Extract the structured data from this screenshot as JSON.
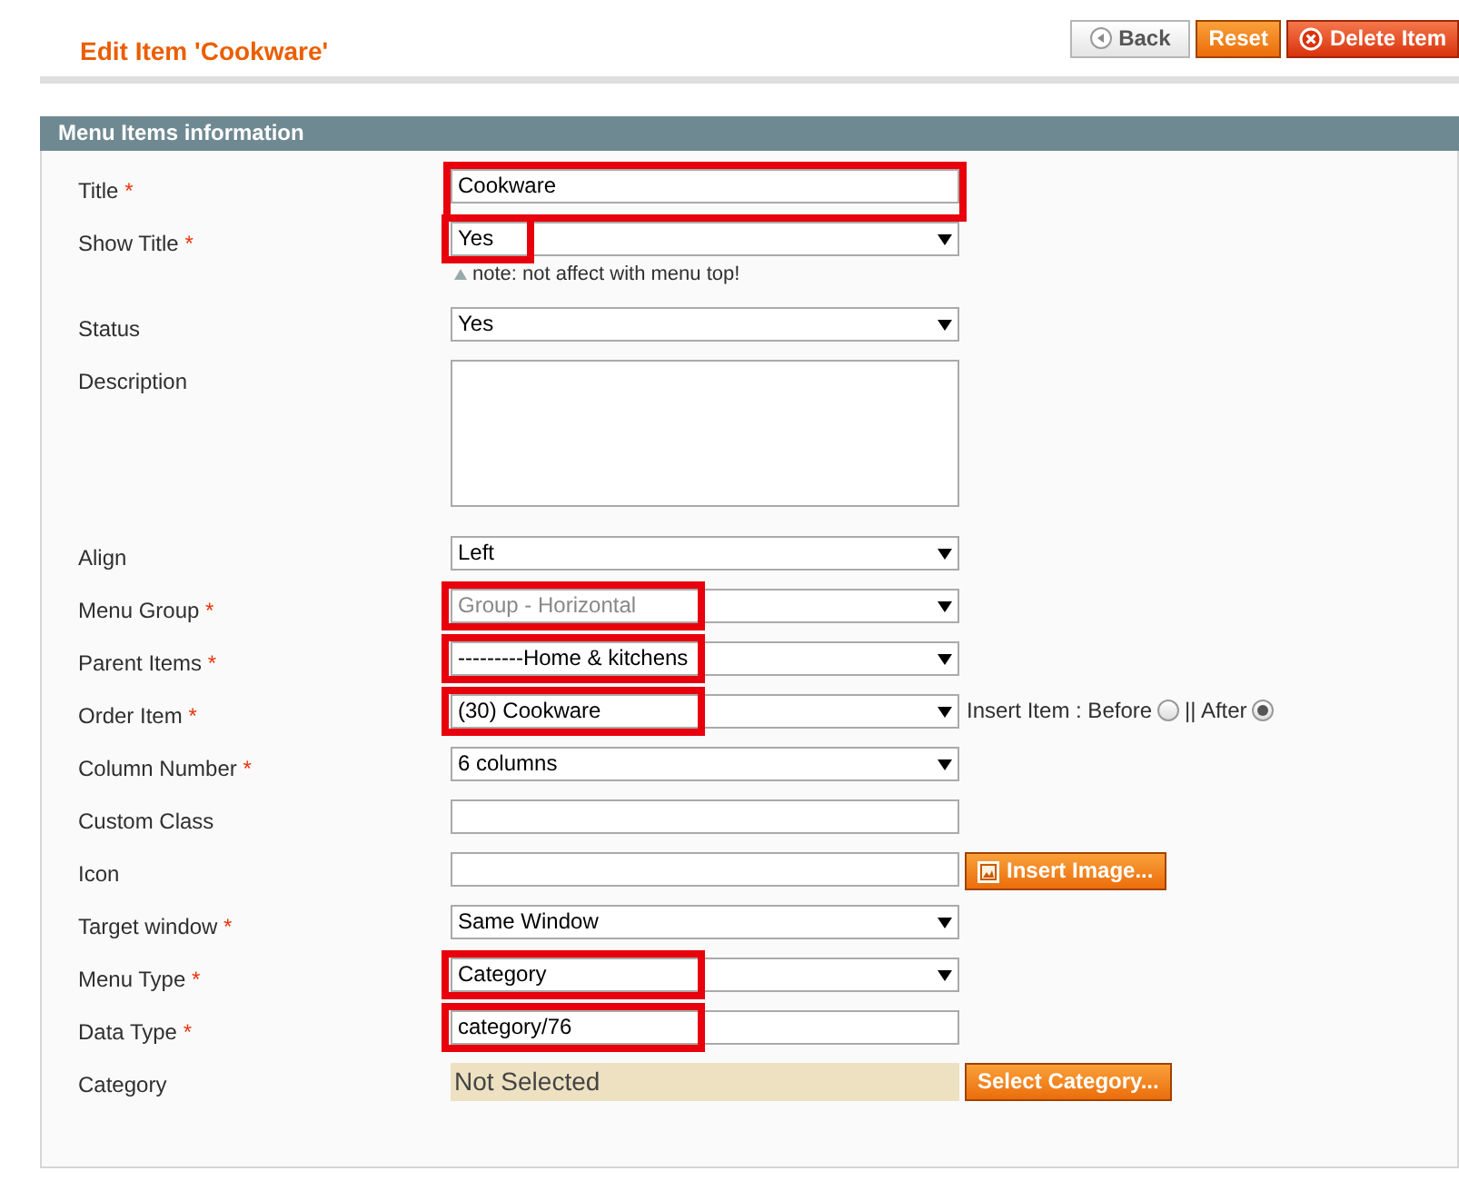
{
  "page_title": "Edit Item 'Cookware'",
  "buttons": [
    {
      "label": "Back",
      "kind": "back"
    },
    {
      "label": "Reset",
      "kind": "plain"
    },
    {
      "label": "Delete Item",
      "kind": "delete"
    }
  ],
  "section": {
    "title": "Menu Items information",
    "fields": [
      {
        "label": "Title",
        "required_mark": "*",
        "kind": "text",
        "value": "Cookware",
        "highlighted": true,
        "highlight_whole": true
      },
      {
        "label": "Show Title",
        "required_mark": "*",
        "kind": "select",
        "value": "Yes",
        "highlighted": true,
        "note": "note: not affect with menu top!"
      },
      {
        "label": "Status",
        "kind": "select",
        "value": "Yes"
      },
      {
        "label": "Description",
        "kind": "textarea"
      },
      {
        "label": "Align",
        "kind": "select",
        "value": "Left"
      },
      {
        "label": "Menu Group",
        "required_mark": "*",
        "kind": "select",
        "value": "Group - Horizontal",
        "highlighted": true,
        "disabled": true
      },
      {
        "label": "Parent Items",
        "required_mark": "*",
        "kind": "select",
        "value": "---------Home & kitchens",
        "highlighted": true
      },
      {
        "label": "Order Item",
        "required_mark": "*",
        "kind": "select",
        "value": "(30) Cookware",
        "highlighted": true,
        "radios": [
          {
            "label": "Insert Item : Before",
            "selected": false
          },
          {
            "label": "|| After",
            "selected": true
          }
        ]
      },
      {
        "label": "Column Number",
        "required_mark": "*",
        "kind": "select",
        "value": "6 columns"
      },
      {
        "label": "Custom Class",
        "kind": "text"
      },
      {
        "label": "Icon",
        "kind": "text",
        "button": "Insert Image..."
      },
      {
        "label": "Target window",
        "required_mark": "*",
        "kind": "select",
        "value": "Same Window"
      },
      {
        "label": "Menu Type",
        "required_mark": "*",
        "kind": "select",
        "value": "Category",
        "highlighted": true
      },
      {
        "label": "Data Type",
        "required_mark": "*",
        "kind": "text",
        "value": "category/76",
        "highlighted": true
      },
      {
        "label": "Category",
        "kind": "picker",
        "value": "Not Selected",
        "button": "Select Category..."
      }
    ]
  }
}
